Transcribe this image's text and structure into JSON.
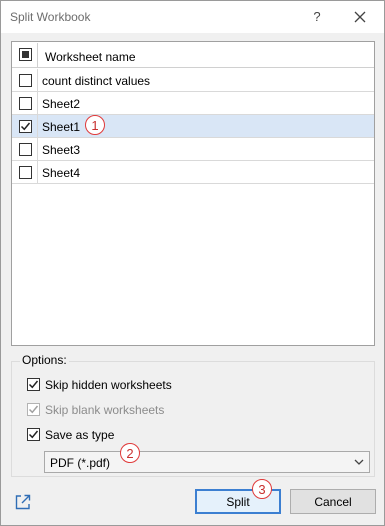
{
  "window": {
    "title": "Split Workbook",
    "help": "?"
  },
  "list": {
    "header": "Worksheet name",
    "rows": [
      {
        "name": "count distinct values",
        "checked": false,
        "selected": false
      },
      {
        "name": "Sheet2",
        "checked": false,
        "selected": false
      },
      {
        "name": "Sheet1",
        "checked": true,
        "selected": true
      },
      {
        "name": "Sheet3",
        "checked": false,
        "selected": false
      },
      {
        "name": "Sheet4",
        "checked": false,
        "selected": false
      }
    ]
  },
  "options": {
    "label": "Options:",
    "skip_hidden": {
      "label": "Skip hidden worksheets",
      "checked": true,
      "enabled": true
    },
    "skip_blank": {
      "label": "Skip blank worksheets",
      "checked": true,
      "enabled": false
    },
    "save_as_type": {
      "label": "Save as type",
      "checked": true,
      "enabled": true
    },
    "type_value": "PDF (*.pdf)"
  },
  "buttons": {
    "split": "Split",
    "cancel": "Cancel"
  },
  "badges": {
    "one": "1",
    "two": "2",
    "three": "3"
  },
  "colors": {
    "badge": "#e03b3b",
    "selection": "#d9e6f6",
    "primary_border": "#3c7fd1"
  }
}
